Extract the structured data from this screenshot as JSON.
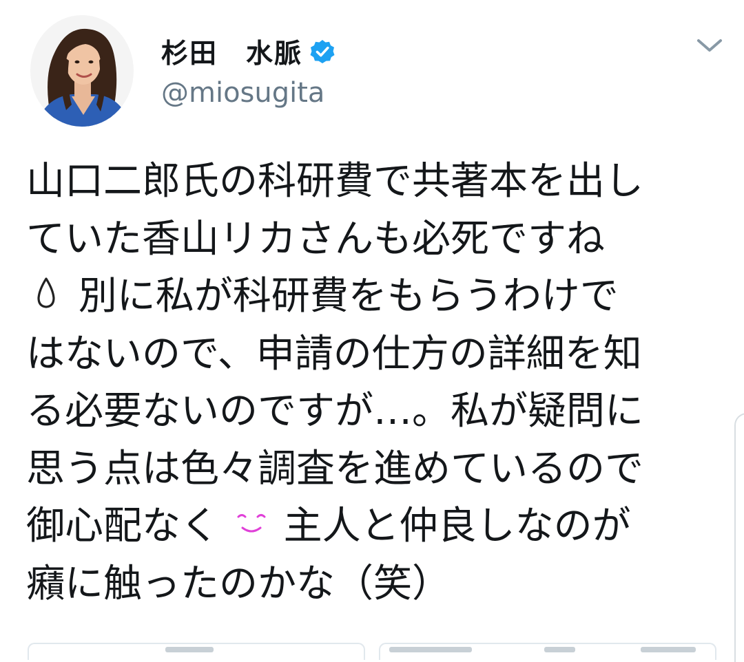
{
  "tweet": {
    "display_name": "杉田　水脈",
    "handle": "@miosugita",
    "verified": true,
    "lines": [
      {
        "before": "山口二郎氏の科研費で共著本を出し",
        "emoji": "",
        "after": ""
      },
      {
        "before": "ていた香山リカさんも必死ですね",
        "emoji": "",
        "after": ""
      },
      {
        "before": "",
        "emoji": "droplet-emoji",
        "after": " 別に私が科研費をもらうわけで"
      },
      {
        "before": "はないので、申請の仕方の詳細を知",
        "emoji": "",
        "after": ""
      },
      {
        "before": "る必要ないのですが…。私が疑問に",
        "emoji": "",
        "after": ""
      },
      {
        "before": "思う点は色々調査を進めているので",
        "emoji": "",
        "after": ""
      },
      {
        "before": "御心配なく ",
        "emoji": "smiling-emoji",
        "after": " 主人と仲良しなのが"
      },
      {
        "before": "癪に触ったのかな（笑）",
        "emoji": "",
        "after": ""
      }
    ]
  },
  "colors": {
    "text": "#14171a",
    "handle": "#657786",
    "verified": "#1da1f2",
    "smile_emoji": "#e040d8",
    "card_border": "#e1e8ed"
  },
  "icons": {
    "verified": "verified-badge-icon",
    "caret": "chevron-down-icon"
  }
}
